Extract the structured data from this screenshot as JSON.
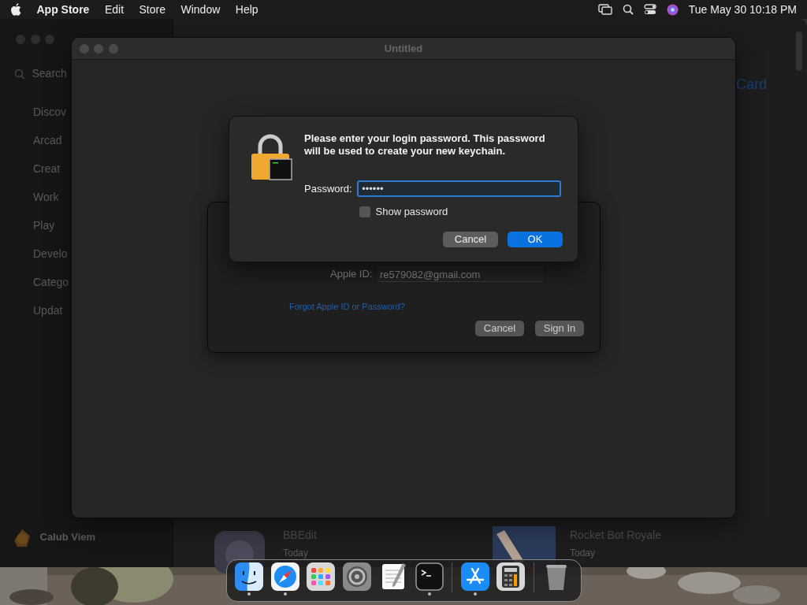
{
  "menu_bar": {
    "app_name": "App Store",
    "menus": [
      "Edit",
      "Store",
      "Window",
      "Help"
    ],
    "clock": "Tue May 30  10:18 PM"
  },
  "app_store_window": {
    "search": {
      "placeholder": "Search"
    },
    "sidebar": {
      "items": [
        {
          "label": "Discov"
        },
        {
          "label": "Arcad"
        },
        {
          "label": "Creat"
        },
        {
          "label": "Work"
        },
        {
          "label": "Play"
        },
        {
          "label": "Develo"
        },
        {
          "label": "Catego"
        },
        {
          "label": "Updat"
        }
      ],
      "account": "Calub Viem"
    },
    "header_link": "Card",
    "apps": [
      {
        "name": "BBEdit",
        "date": "Today"
      },
      {
        "name": "Rocket Bot Royale",
        "date": "Today"
      }
    ]
  },
  "untitled_window": {
    "title": "Untitled"
  },
  "sign_in_sheet": {
    "apple_id_label": "Apple ID:",
    "apple_id_value": "re579082@gmail.com",
    "forgot_link": "Forgot Apple ID or Password?",
    "buttons": [
      {
        "label": "Cancel"
      },
      {
        "label": "Sign In"
      }
    ]
  },
  "password_dialog": {
    "message": "Please enter your login password. This password will be used to create your new keychain.",
    "password_label": "Password:",
    "password_value": "••••••",
    "show_password": {
      "label": "Show password",
      "checked": false
    },
    "buttons": [
      {
        "label": "Cancel",
        "kind": "normal"
      },
      {
        "label": "OK",
        "kind": "default"
      }
    ]
  },
  "dock": {
    "items": [
      {
        "kind": "finder",
        "running": true
      },
      {
        "kind": "safari",
        "running": true
      },
      {
        "kind": "launchpad",
        "running": false
      },
      {
        "kind": "settings",
        "running": false
      },
      {
        "kind": "textedit",
        "running": false
      },
      {
        "kind": "terminal",
        "running": true
      },
      {
        "kind": "separator"
      },
      {
        "kind": "appstore",
        "running": true
      },
      {
        "kind": "calculator",
        "running": false
      },
      {
        "kind": "separator"
      },
      {
        "kind": "trash",
        "running": false
      }
    ]
  }
}
